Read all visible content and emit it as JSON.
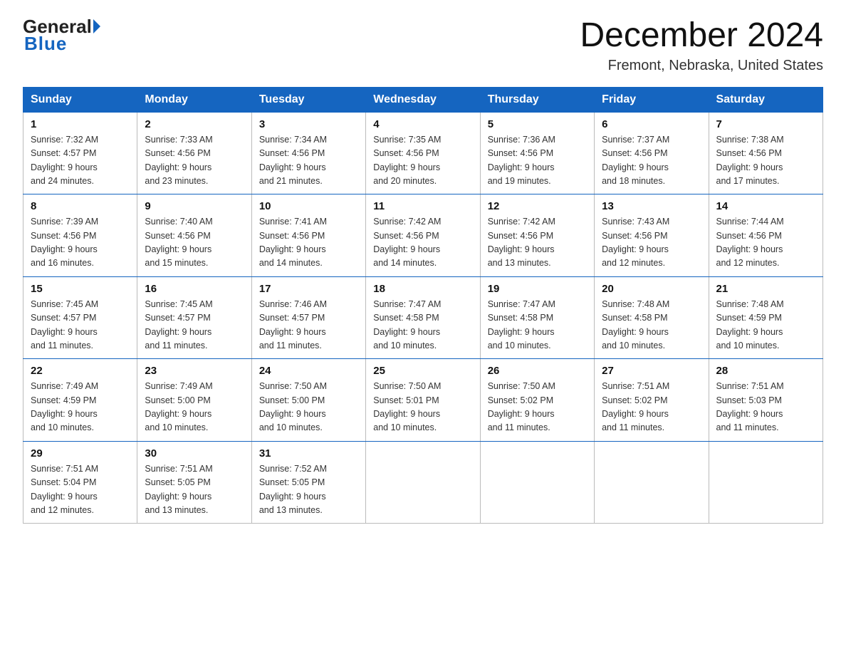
{
  "header": {
    "logo": {
      "part1": "General",
      "arrow": "▶",
      "part2": "Blue"
    },
    "title": "December 2024",
    "subtitle": "Fremont, Nebraska, United States"
  },
  "days_of_week": [
    "Sunday",
    "Monday",
    "Tuesday",
    "Wednesday",
    "Thursday",
    "Friday",
    "Saturday"
  ],
  "weeks": [
    [
      {
        "day": 1,
        "sunrise": "7:32 AM",
        "sunset": "4:57 PM",
        "daylight": "9 hours and 24 minutes."
      },
      {
        "day": 2,
        "sunrise": "7:33 AM",
        "sunset": "4:56 PM",
        "daylight": "9 hours and 23 minutes."
      },
      {
        "day": 3,
        "sunrise": "7:34 AM",
        "sunset": "4:56 PM",
        "daylight": "9 hours and 21 minutes."
      },
      {
        "day": 4,
        "sunrise": "7:35 AM",
        "sunset": "4:56 PM",
        "daylight": "9 hours and 20 minutes."
      },
      {
        "day": 5,
        "sunrise": "7:36 AM",
        "sunset": "4:56 PM",
        "daylight": "9 hours and 19 minutes."
      },
      {
        "day": 6,
        "sunrise": "7:37 AM",
        "sunset": "4:56 PM",
        "daylight": "9 hours and 18 minutes."
      },
      {
        "day": 7,
        "sunrise": "7:38 AM",
        "sunset": "4:56 PM",
        "daylight": "9 hours and 17 minutes."
      }
    ],
    [
      {
        "day": 8,
        "sunrise": "7:39 AM",
        "sunset": "4:56 PM",
        "daylight": "9 hours and 16 minutes."
      },
      {
        "day": 9,
        "sunrise": "7:40 AM",
        "sunset": "4:56 PM",
        "daylight": "9 hours and 15 minutes."
      },
      {
        "day": 10,
        "sunrise": "7:41 AM",
        "sunset": "4:56 PM",
        "daylight": "9 hours and 14 minutes."
      },
      {
        "day": 11,
        "sunrise": "7:42 AM",
        "sunset": "4:56 PM",
        "daylight": "9 hours and 14 minutes."
      },
      {
        "day": 12,
        "sunrise": "7:42 AM",
        "sunset": "4:56 PM",
        "daylight": "9 hours and 13 minutes."
      },
      {
        "day": 13,
        "sunrise": "7:43 AM",
        "sunset": "4:56 PM",
        "daylight": "9 hours and 12 minutes."
      },
      {
        "day": 14,
        "sunrise": "7:44 AM",
        "sunset": "4:56 PM",
        "daylight": "9 hours and 12 minutes."
      }
    ],
    [
      {
        "day": 15,
        "sunrise": "7:45 AM",
        "sunset": "4:57 PM",
        "daylight": "9 hours and 11 minutes."
      },
      {
        "day": 16,
        "sunrise": "7:45 AM",
        "sunset": "4:57 PM",
        "daylight": "9 hours and 11 minutes."
      },
      {
        "day": 17,
        "sunrise": "7:46 AM",
        "sunset": "4:57 PM",
        "daylight": "9 hours and 11 minutes."
      },
      {
        "day": 18,
        "sunrise": "7:47 AM",
        "sunset": "4:58 PM",
        "daylight": "9 hours and 10 minutes."
      },
      {
        "day": 19,
        "sunrise": "7:47 AM",
        "sunset": "4:58 PM",
        "daylight": "9 hours and 10 minutes."
      },
      {
        "day": 20,
        "sunrise": "7:48 AM",
        "sunset": "4:58 PM",
        "daylight": "9 hours and 10 minutes."
      },
      {
        "day": 21,
        "sunrise": "7:48 AM",
        "sunset": "4:59 PM",
        "daylight": "9 hours and 10 minutes."
      }
    ],
    [
      {
        "day": 22,
        "sunrise": "7:49 AM",
        "sunset": "4:59 PM",
        "daylight": "9 hours and 10 minutes."
      },
      {
        "day": 23,
        "sunrise": "7:49 AM",
        "sunset": "5:00 PM",
        "daylight": "9 hours and 10 minutes."
      },
      {
        "day": 24,
        "sunrise": "7:50 AM",
        "sunset": "5:00 PM",
        "daylight": "9 hours and 10 minutes."
      },
      {
        "day": 25,
        "sunrise": "7:50 AM",
        "sunset": "5:01 PM",
        "daylight": "9 hours and 10 minutes."
      },
      {
        "day": 26,
        "sunrise": "7:50 AM",
        "sunset": "5:02 PM",
        "daylight": "9 hours and 11 minutes."
      },
      {
        "day": 27,
        "sunrise": "7:51 AM",
        "sunset": "5:02 PM",
        "daylight": "9 hours and 11 minutes."
      },
      {
        "day": 28,
        "sunrise": "7:51 AM",
        "sunset": "5:03 PM",
        "daylight": "9 hours and 11 minutes."
      }
    ],
    [
      {
        "day": 29,
        "sunrise": "7:51 AM",
        "sunset": "5:04 PM",
        "daylight": "9 hours and 12 minutes."
      },
      {
        "day": 30,
        "sunrise": "7:51 AM",
        "sunset": "5:05 PM",
        "daylight": "9 hours and 13 minutes."
      },
      {
        "day": 31,
        "sunrise": "7:52 AM",
        "sunset": "5:05 PM",
        "daylight": "9 hours and 13 minutes."
      },
      null,
      null,
      null,
      null
    ]
  ],
  "labels": {
    "sunrise": "Sunrise:",
    "sunset": "Sunset:",
    "daylight": "Daylight:"
  }
}
